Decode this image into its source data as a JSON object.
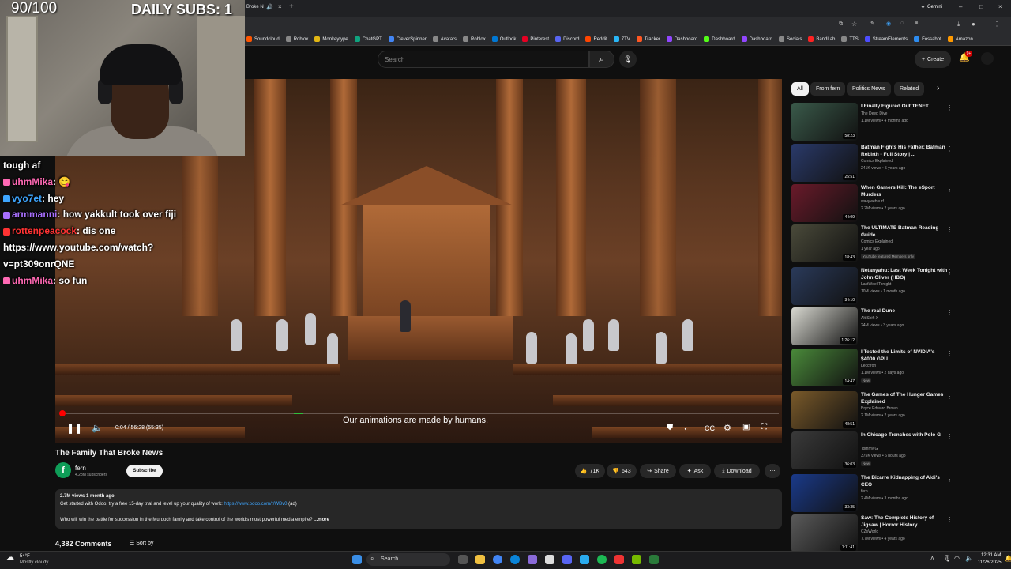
{
  "browser": {
    "active_tab": "Broke N",
    "gemini_label": "Gemini",
    "bookmarks": [
      {
        "label": "Soundcloud",
        "color": "#ff5500"
      },
      {
        "label": "Roblox",
        "color": "#888888"
      },
      {
        "label": "Monkeytype",
        "color": "#e2b714"
      },
      {
        "label": "ChatGPT",
        "color": "#10a37f"
      },
      {
        "label": "CleverSpinner",
        "color": "#4285f4"
      },
      {
        "label": "Avatars",
        "color": "#888888"
      },
      {
        "label": "Roblox",
        "color": "#888888"
      },
      {
        "label": "Outlook",
        "color": "#0078d4"
      },
      {
        "label": "Pinterest",
        "color": "#e60023"
      },
      {
        "label": "Discord",
        "color": "#5865f2"
      },
      {
        "label": "Reddit",
        "color": "#ff4500"
      },
      {
        "label": "7TV",
        "color": "#29b6f6"
      },
      {
        "label": "Tracker",
        "color": "#ff5722"
      },
      {
        "label": "Dashboard",
        "color": "#9146ff"
      },
      {
        "label": "Dashboard",
        "color": "#53fc18"
      },
      {
        "label": "Dashboard",
        "color": "#9146ff"
      },
      {
        "label": "Socials",
        "color": "#888888"
      },
      {
        "label": "BandLab",
        "color": "#f22"
      },
      {
        "label": "TTS",
        "color": "#888888"
      },
      {
        "label": "StreamElements",
        "color": "#4d4dff"
      },
      {
        "label": "Fossabot",
        "color": "#2d8cf0"
      },
      {
        "label": "Amazon",
        "color": "#ff9900"
      }
    ]
  },
  "header": {
    "search_placeholder": "Search",
    "create_label": "Create",
    "notification_count": "9+"
  },
  "stream_overlay": {
    "score": "90/100",
    "daily_subs": "DAILY SUBS: 1",
    "chat": [
      {
        "user": "",
        "text": "tough af",
        "user_color": "#ffffff"
      },
      {
        "user": "uhmMika",
        "text": ": 😋",
        "user_color": "#ff69b4"
      },
      {
        "user": "vyo7et",
        "text": ": hey",
        "user_color": "#3ea6ff"
      },
      {
        "user": "armmanni",
        "text": ": how yakkult took over fiji",
        "user_color": "#a970ff"
      },
      {
        "user": "rottenpeacock",
        "text": ": dis one",
        "user_color": "#ff3333"
      },
      {
        "user": "",
        "text": "https://www.youtube.com/watch?",
        "user_color": "#ffffff"
      },
      {
        "user": "",
        "text": "v=pt309onrQNE",
        "user_color": "#ffffff"
      },
      {
        "user": "uhmMika",
        "text": ": so fun",
        "user_color": "#ff69b4"
      }
    ]
  },
  "player": {
    "caption": "Our animations are made by humans.",
    "timecode": "0:04 / 56:28 (55:35)",
    "progress_fraction": 0.001
  },
  "video": {
    "title": "The Family That Broke News",
    "channel": "fern",
    "subscribers": "4.28M subscribers",
    "subscribe_label": "Subscribe",
    "likes": "71K",
    "dislikes": "643",
    "share_label": "Share",
    "ask_label": "Ask",
    "download_label": "Download",
    "description": {
      "meta": "2.7M views  1 month ago",
      "line1_prefix": "Get started with Odoo, try a free 15-day trial and level up your quality of work: ",
      "line1_link": "https://www.odoo.com/r/WBv0",
      "line1_suffix": " (ad)",
      "line2": "Who will win the battle for succession in the Murdoch family and take control of the world's most powerful media empire?",
      "more_label": " ...more"
    },
    "comments_count": "4,382 Comments",
    "sort_label": "Sort by"
  },
  "sidebar": {
    "chips": [
      "All",
      "From fern",
      "Politics News",
      "Related"
    ],
    "recommendations": [
      {
        "title": "I Finally Figured Out TENET",
        "channel": "The Deep Dive",
        "meta": "1.1M views • 4 months ago",
        "duration": "58:23",
        "color": "#3a5a4a"
      },
      {
        "title": "Batman Fights His Father: Batman Rebirth - Full Story | ...",
        "channel": "Comics Explained",
        "meta": "241K views • 5 years ago",
        "duration": "25:51",
        "color": "#2a3a6a"
      },
      {
        "title": "When Gamers Kill: The eSport Murders",
        "channel": "wavywebsurf",
        "meta": "2.2M views • 2 years ago",
        "duration": "44:09",
        "color": "#6a1a2a"
      },
      {
        "title": "The ULTIMATE Batman Reading Guide",
        "channel": "Comics Explained",
        "meta": "1 year ago",
        "duration": "18:43",
        "color": "#4a4a3a",
        "badge": "YouTube featured   Members only"
      },
      {
        "title": "Netanyahu: Last Week Tonight with John Oliver (HBO)",
        "channel": "LastWeekTonight",
        "meta": "10M views • 1 month ago",
        "duration": "34:10",
        "color": "#2a3a5a"
      },
      {
        "title": "The real Dune",
        "channel": "Alt Shift X",
        "meta": "24M views • 3 years ago",
        "duration": "1:26:12",
        "color": "#d8d8d0"
      },
      {
        "title": "I Tested the Limits of NVIDIA's $4000 GPU",
        "channel": "Lecctron",
        "meta": "1.1M views • 2 days ago",
        "duration": "14:47",
        "color": "#4a8a3a",
        "badge": "New"
      },
      {
        "title": "The Games of The Hunger Games Explained",
        "channel": "Bryce Edward Brown",
        "meta": "2.1M views • 2 years ago",
        "duration": "48:51",
        "color": "#7a5a2a"
      },
      {
        "title": "In Chicago Trenches with Polo G",
        "channel": "Tommy G",
        "meta": "375K views • 6 hours ago",
        "duration": "36:03",
        "color": "#3a3a3a",
        "badge": "New"
      },
      {
        "title": "The Bizarre Kidnapping of Aldi's CEO",
        "channel": "fern",
        "meta": "2.4M views • 3 months ago",
        "duration": "33:35",
        "color": "#1a3a8a"
      },
      {
        "title": "Saw: The Complete History of Jigsaw | Horror History",
        "channel": "CZsWorld",
        "meta": "7.7M views • 4 years ago",
        "duration": "1:11:41",
        "color": "#5a5a5a"
      }
    ]
  },
  "taskbar": {
    "weather_temp": "54°F",
    "weather_desc": "Mostly cloudy",
    "search_label": "Search",
    "time": "12:31 AM",
    "date": "11/26/2025"
  }
}
